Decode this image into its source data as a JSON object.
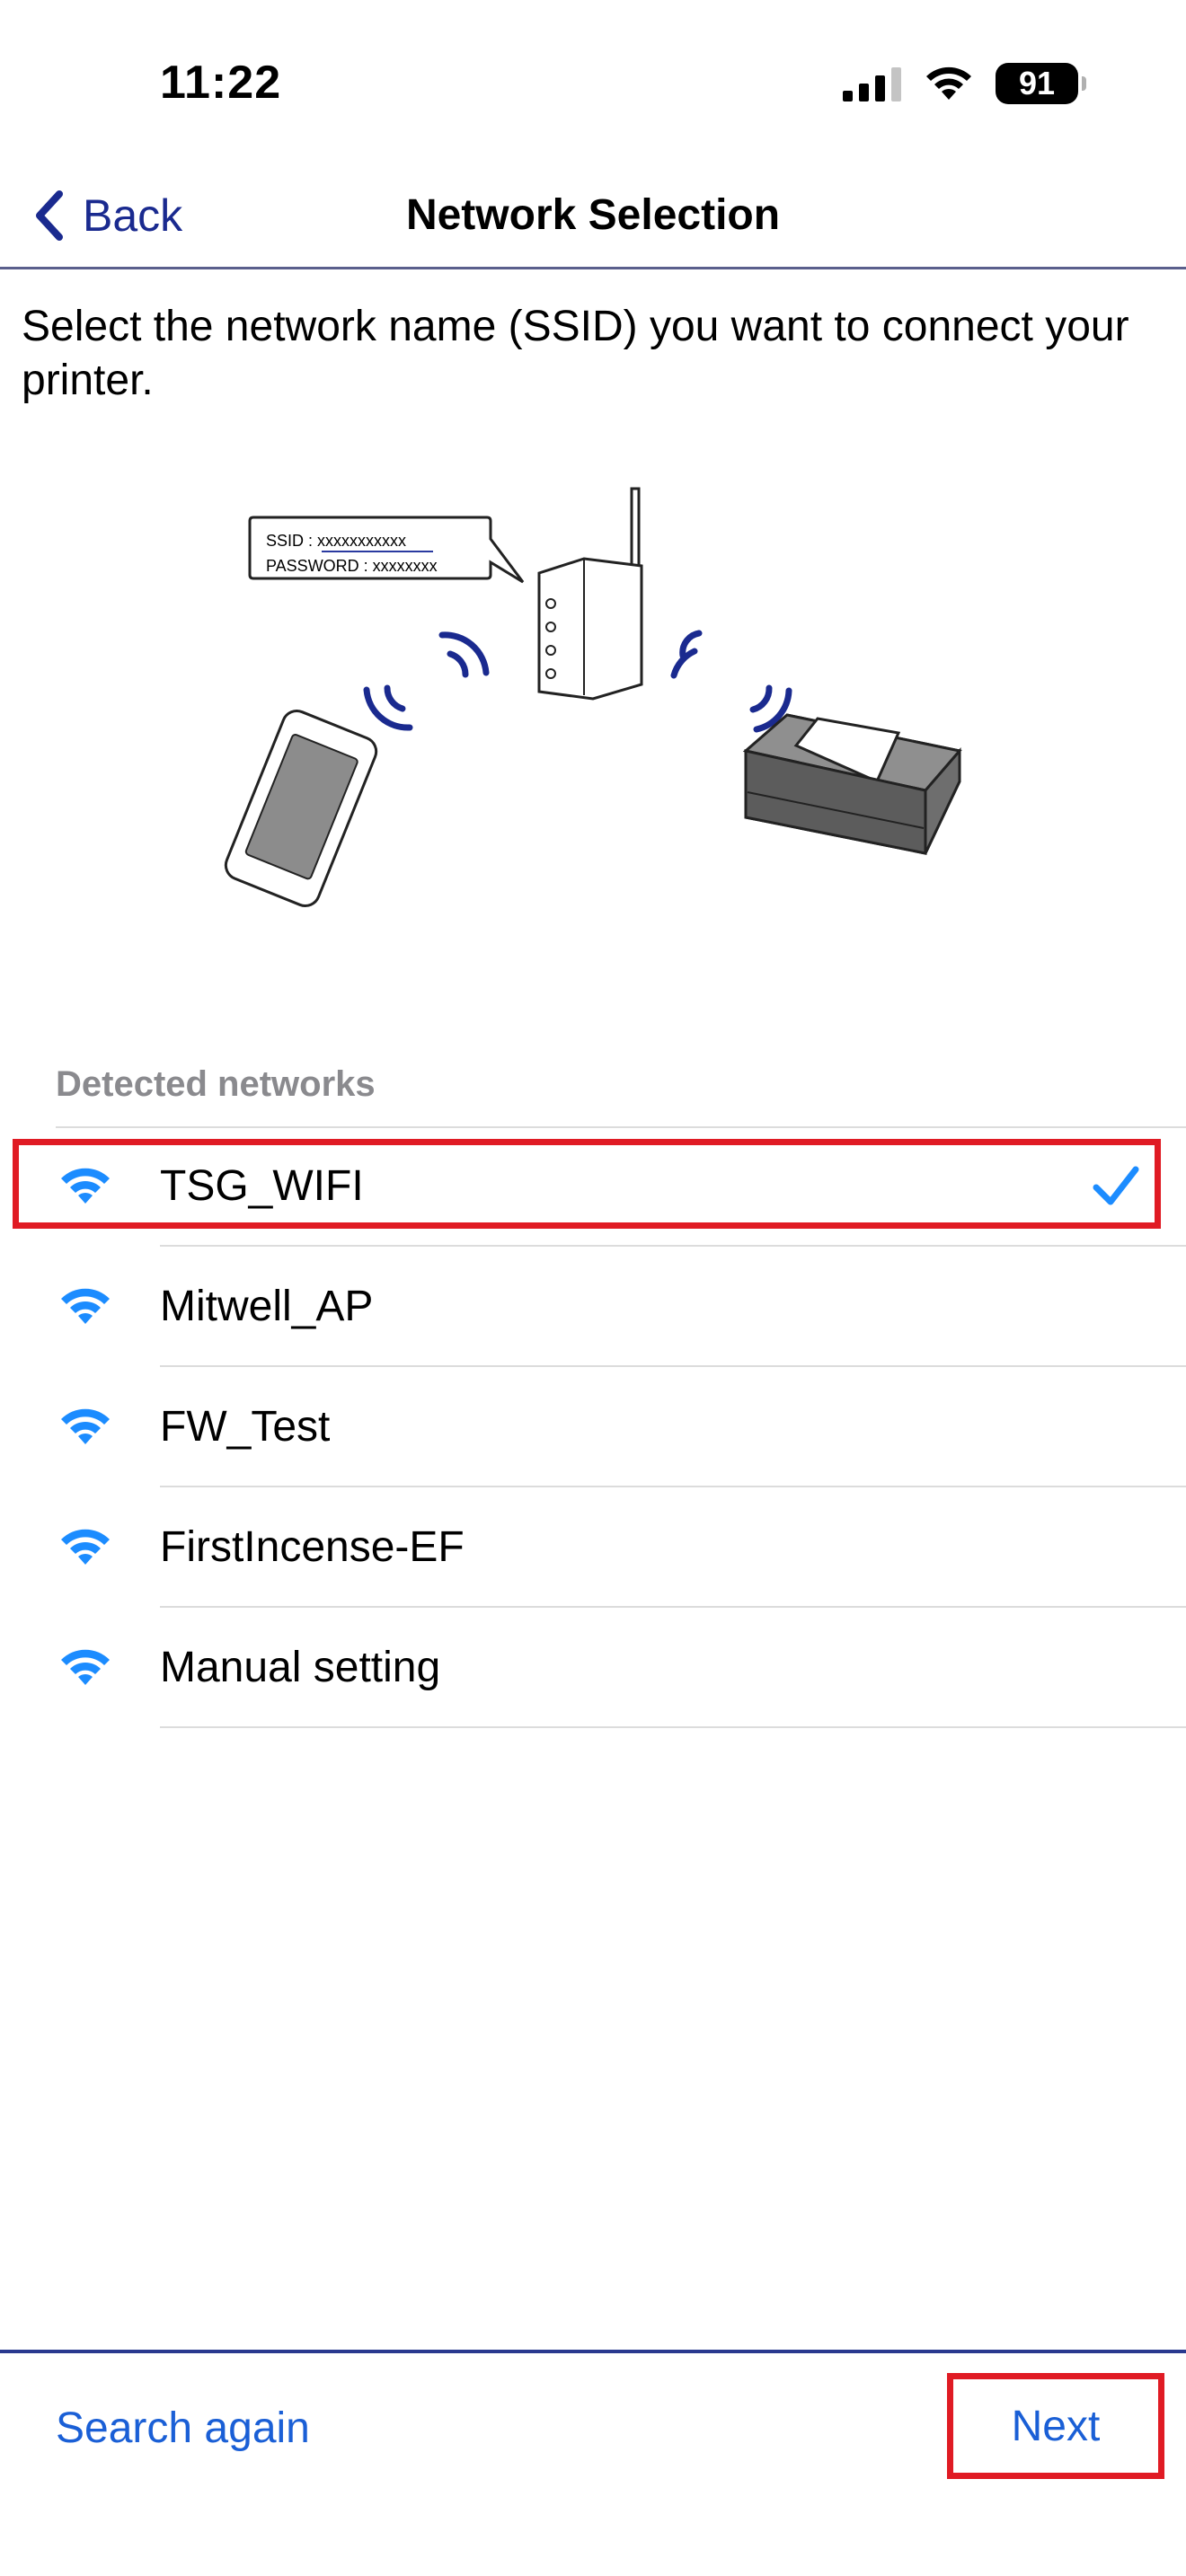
{
  "status_bar": {
    "time": "11:22",
    "battery": "91"
  },
  "nav": {
    "back_label": "Back",
    "title": "Network Selection"
  },
  "instruction": "Select the network name (SSID) you want to connect your printer.",
  "illustration": {
    "ssid_line": "SSID : xxxxxxxxxxx",
    "password_line": "PASSWORD : xxxxxxxx"
  },
  "networks": {
    "header": "Detected networks",
    "items": [
      {
        "name": "TSG_WIFI",
        "selected": true
      },
      {
        "name": "Mitwell_AP",
        "selected": false
      },
      {
        "name": "FW_Test",
        "selected": false
      },
      {
        "name": "FirstIncense-EF",
        "selected": false
      },
      {
        "name": "Manual setting",
        "selected": false
      }
    ]
  },
  "footer": {
    "search_again_label": "Search again",
    "next_label": "Next"
  },
  "colors": {
    "accent_blue": "#1a5fd6",
    "nav_blue": "#1a2a8f",
    "wifi_icon": "#1c8cff",
    "highlight_red": "#e01b24"
  }
}
